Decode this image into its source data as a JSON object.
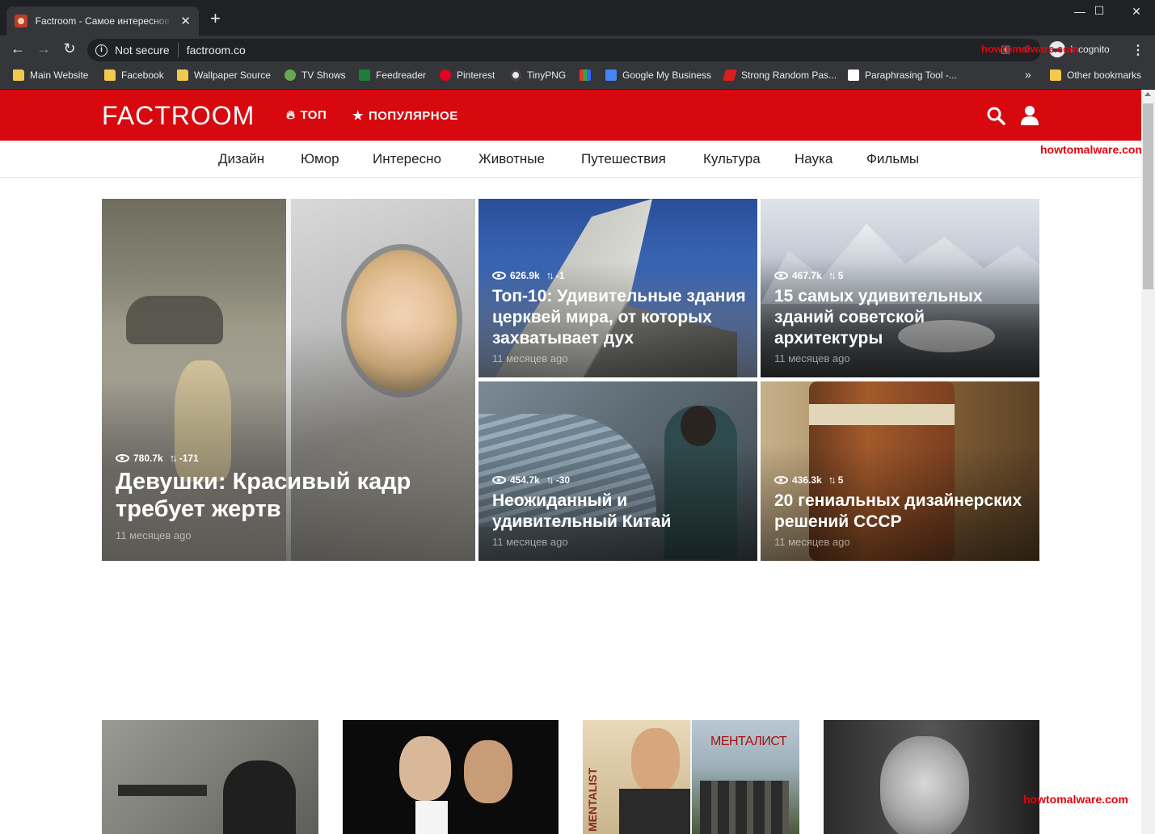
{
  "browser": {
    "tab_title": "Factroom - Самое интересное в",
    "security_text": "Not secure",
    "url": "factroom.co",
    "incognito_label": "Incognito",
    "bookmarks": [
      {
        "label": "Main Website",
        "icon": "folder-icon"
      },
      {
        "label": "Facebook",
        "icon": "folder-icon"
      },
      {
        "label": "Wallpaper Source",
        "icon": "folder-icon"
      },
      {
        "label": "TV Shows",
        "icon": "play-icon"
      },
      {
        "label": "Feedreader",
        "icon": "feedreader-icon"
      },
      {
        "label": "Pinterest",
        "icon": "pinterest-icon"
      },
      {
        "label": "TinyPNG",
        "icon": "panda-icon"
      },
      {
        "label": "Google My Business",
        "icon": "gmb-icon"
      },
      {
        "label": "Strong Random Pas...",
        "icon": "key-icon"
      },
      {
        "label": "Paraphrasing Tool -...",
        "icon": "page-icon"
      }
    ],
    "overflow_label": "»",
    "other_bookmarks": "Other bookmarks"
  },
  "watermark": "howtomalware.com",
  "site": {
    "logo": "FACTROOM",
    "nav_top": "ТОП",
    "nav_popular": "ПОПУЛЯРНОЕ",
    "categories": [
      "Дизайн",
      "Юмор",
      "Интересно",
      "Животные",
      "Путешествия",
      "Культура",
      "Наука",
      "Фильмы"
    ],
    "accent_color": "#d8090e"
  },
  "featured": [
    {
      "views": "780.7k",
      "score": "-171",
      "title": "Девушки: Красивый кадр требует жертв",
      "date": "11 месяцев ago"
    },
    {
      "views": "626.9k",
      "score": "-1",
      "title": "Топ-10: Удивительные здания церквей мира, от которых захватывает дух",
      "date": "11 месяцев ago"
    },
    {
      "views": "467.7k",
      "score": "5",
      "title": "15 самых удивительных зданий советской архитектуры",
      "date": "11 месяцев ago"
    },
    {
      "views": "454.7k",
      "score": "-30",
      "title": "Неожиданный и удивительный Китай",
      "date": "11 месяцев ago"
    },
    {
      "views": "436.3k",
      "score": "5",
      "title": "20 гениальных дизайнерских решений СССР",
      "date": "11 месяцев ago"
    }
  ],
  "thumb_texts": {
    "mentalist_en": "MENTALIST",
    "mentalist_ru": "МЕНТАЛИСТ"
  }
}
